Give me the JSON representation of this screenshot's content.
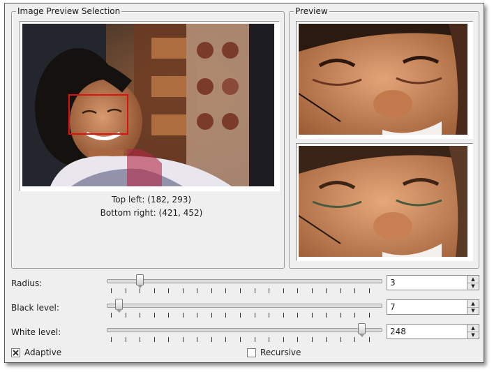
{
  "image_preview_selection": {
    "title": "Image Preview Selection",
    "top_left_text": "Top left: (182, 293)",
    "bottom_right_text": "Bottom right: (421, 452)"
  },
  "preview": {
    "title": "Preview"
  },
  "controls": {
    "radius": {
      "label": "Radius:",
      "value": "3",
      "slider_fraction": 0.11
    },
    "black_level": {
      "label": "Black level:",
      "value": "7",
      "slider_fraction": 0.03
    },
    "white_level": {
      "label": "White level:",
      "value": "248",
      "slider_fraction": 0.97
    }
  },
  "options": {
    "adaptive": {
      "label": "Adaptive",
      "checked": true
    },
    "recursive": {
      "label": "Recursive",
      "checked": false
    }
  },
  "colors": {
    "selection_rect": "#e01010"
  }
}
